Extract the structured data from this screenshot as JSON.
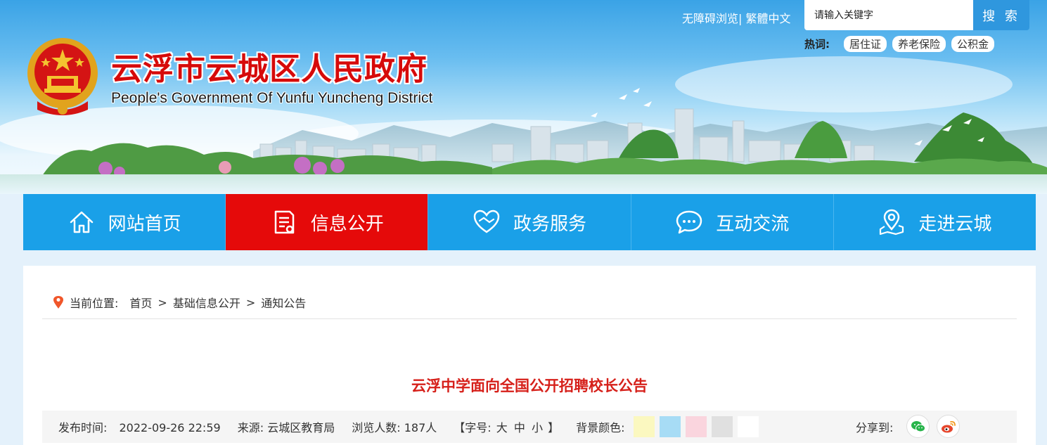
{
  "header": {
    "title": "云浮市云城区人民政府",
    "subtitle": "People's Government Of Yunfu Yuncheng District",
    "accessibility_link": "无障碍浏览|",
    "traditional_link": "繁體中文",
    "search": {
      "placeholder": "请输入关键字",
      "button_label": "搜 索"
    },
    "hotwords_label": "热词:",
    "hotwords": [
      "居住证",
      "养老保险",
      "公积金"
    ]
  },
  "nav": {
    "items": [
      {
        "label": "网站首页",
        "icon": "home-icon"
      },
      {
        "label": "信息公开",
        "icon": "document-icon",
        "active": true
      },
      {
        "label": "政务服务",
        "icon": "handshake-icon"
      },
      {
        "label": "互动交流",
        "icon": "chat-icon"
      },
      {
        "label": "走进云城",
        "icon": "map-pin-icon"
      }
    ]
  },
  "breadcrumb": {
    "label": "当前位置:",
    "items": [
      "首页",
      "基础信息公开",
      "通知公告"
    ],
    "separator": ">"
  },
  "article": {
    "title": "云浮中学面向全国公开招聘校长公告",
    "publish_label": "发布时间:",
    "publish_time": "2022-09-26 22:59",
    "source_label": "来源:",
    "source": "云城区教育局",
    "views_label": "浏览人数:",
    "views": "187人",
    "font_size_label": "【字号:",
    "font_sizes": [
      "大",
      "中",
      "小"
    ],
    "font_size_close": "】",
    "bg_color_label": "背景颜色:",
    "bg_colors": [
      "#fbf8c0",
      "#a7dcf5",
      "#fad5de",
      "#e0e0e0",
      "#ffffff"
    ],
    "share_label": "分享到:"
  },
  "colors": {
    "accent_red": "#e50a0a",
    "nav_blue": "#1aa0e8",
    "title_red": "#d6201a"
  }
}
